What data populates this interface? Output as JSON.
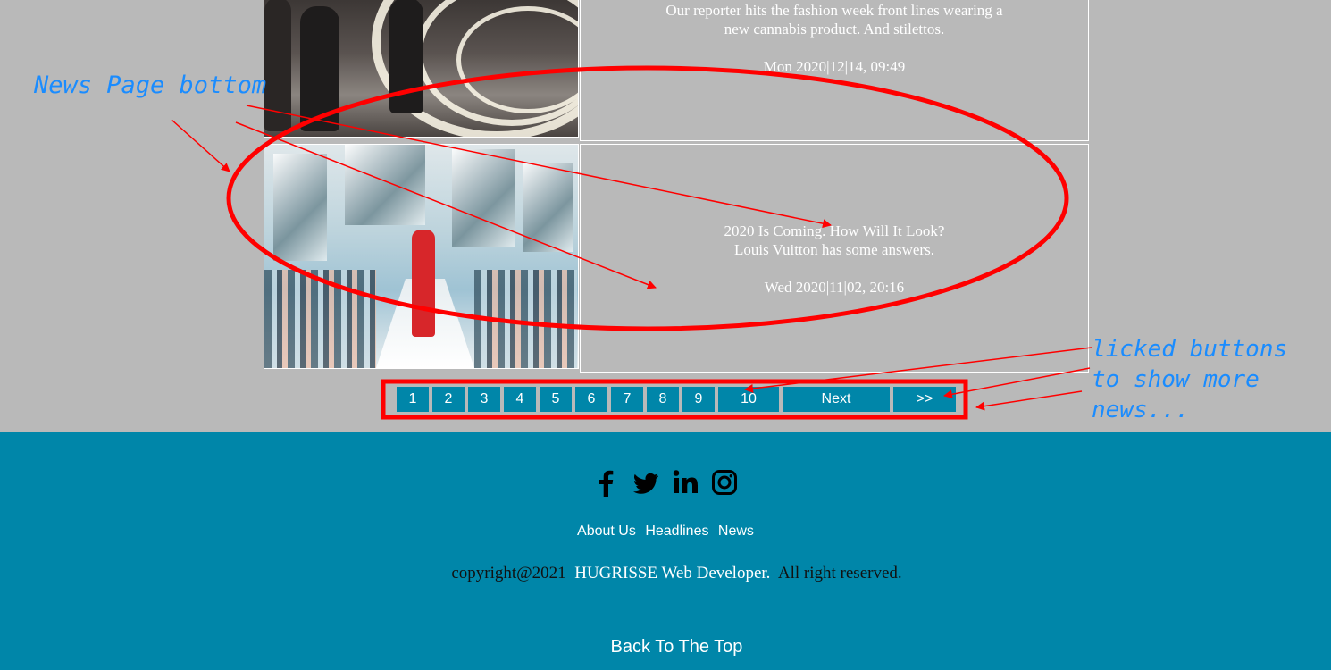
{
  "news": [
    {
      "headline_line1": "Our reporter hits the fashion week front lines wearing a",
      "headline_line2": "new cannabis product. And stilettos.",
      "date": "Mon 2020|12|14, 09:49"
    },
    {
      "headline_line1": "2020 Is Coming. How Will It Look?",
      "headline_line2": "Louis Vuitton has some answers.",
      "date": "Wed 2020|11|02, 20:16"
    }
  ],
  "pagination": {
    "pages": [
      "1",
      "2",
      "3",
      "4",
      "5",
      "6",
      "7",
      "8",
      "9",
      "10"
    ],
    "next_label": "Next",
    "last_label": ">>"
  },
  "annotations": {
    "left": "News Page bottom",
    "right_line1": "licked buttons",
    "right_line2": "to show more",
    "right_line3": "news..."
  },
  "footer": {
    "social": [
      "facebook-icon",
      "twitter-icon",
      "linkedin-icon",
      "instagram-icon"
    ],
    "nav": [
      "About Us",
      "Headlines",
      "News"
    ],
    "copyright_prefix": "copyright@2021",
    "copyright_brand": "HUGRISSE Web Developer.",
    "copyright_suffix": "All right reserved.",
    "back_to_top": "Back To The Top"
  },
  "colors": {
    "page_bg": "#b9b9b9",
    "accent": "#0086a9",
    "annotation_red": "#ff0000",
    "annotation_blue": "#1a8cff"
  }
}
